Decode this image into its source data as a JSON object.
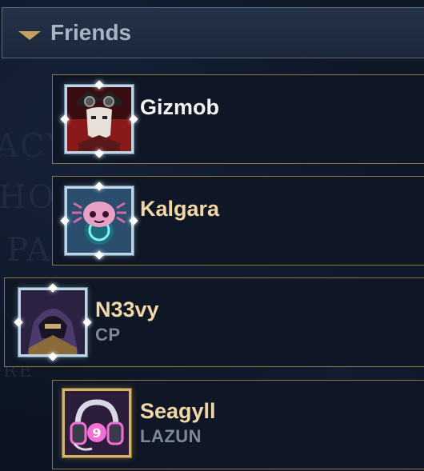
{
  "section": {
    "title": "Friends",
    "expanded": true
  },
  "background_text": [
    "ACY",
    "HO",
    "PA",
    "RE"
  ],
  "friends": [
    {
      "name": "Gizmob",
      "status": "",
      "name_color": "#f4f4f4"
    },
    {
      "name": "Kalgara",
      "status": "",
      "name_color": "#f2d7a6"
    },
    {
      "name": "N33vy",
      "status": "CP",
      "name_color": "#f2d7a6"
    },
    {
      "name": "Seagyll",
      "status": "LAZUN",
      "name_color": "#f2d7a6"
    }
  ]
}
